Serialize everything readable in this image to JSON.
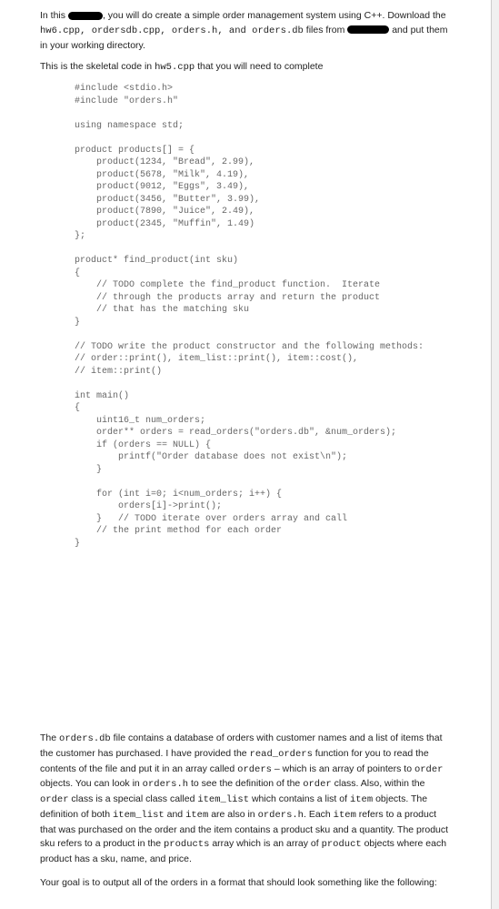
{
  "intro": {
    "p1_a": "In this ",
    "p1_b": ", you will do create a simple order management system using C++.  Download the ",
    "p1_c": " files from ",
    "p1_d": " and put them in your working directory.",
    "files_list": "hw6.cpp, ordersdb.cpp, orders.h, and orders.db",
    "p2_a": "This is the skeletal code in ",
    "p2_b": " that you will need to complete",
    "skeletal_file": "hw5.cpp"
  },
  "code": "#include <stdio.h>\n#include \"orders.h\"\n\nusing namespace std;\n\nproduct products[] = {\n    product(1234, \"Bread\", 2.99),\n    product(5678, \"Milk\", 4.19),\n    product(9012, \"Eggs\", 3.49),\n    product(3456, \"Butter\", 3.99),\n    product(7890, \"Juice\", 2.49),\n    product(2345, \"Muffin\", 1.49)\n};\n\nproduct* find_product(int sku)\n{\n    // TODO complete the find_product function.  Iterate\n    // through the products array and return the product\n    // that has the matching sku\n}\n\n// TODO write the product constructor and the following methods:\n// order::print(), item_list::print(), item::cost(),\n// item::print()\n\nint main()\n{\n    uint16_t num_orders;\n    order** orders = read_orders(\"orders.db\", &num_orders);\n    if (orders == NULL) {\n        printf(\"Order database does not exist\\n\");\n    }\n\n    for (int i=0; i<num_orders; i++) {\n        orders[i]->print();\n    }   // TODO iterate over orders array and call\n    // the print method for each order\n}",
  "bottom": {
    "p1_a": "The ",
    "p1_file1": "orders.db",
    "p1_b": " file contains a database of orders with customer names and a list of items that the customer has purchased.  I have provided the ",
    "p1_func": "read_orders",
    "p1_c": " function for you to read the contents of the file and put it in an array called ",
    "p1_arr": "orders",
    "p1_d": " – which is an array of pointers to ",
    "p1_order": "order",
    "p1_e": " objects.  You can look in ",
    "p1_file2": "orders.h",
    "p1_f": " to see the definition of the ",
    "p1_order2": "order",
    "p1_g": " class.  Also, within the ",
    "p1_order3": "order",
    "p1_h": " class is a special class called ",
    "p1_itemlist": "item_list",
    "p1_i": " which contains a list of ",
    "p1_item": "item",
    "p1_j": " objects.  The definition of both ",
    "p1_itemlist2": "item_list",
    "p1_k": " and ",
    "p1_item2": "item",
    "p1_l": " are also in ",
    "p1_file3": "orders.h",
    "p1_m": ".  Each ",
    "p1_item3": "item",
    "p1_n": " refers to a product that was purchased on the order and the item contains a product sku and a quantity.  The product sku refers to a product in the ",
    "p1_products": "products",
    "p1_o": " array which is an array of ",
    "p1_product": "product",
    "p1_p": " objects where each product has a sku, name, and price.",
    "p2": "Your goal is to output all of the orders in a format that should look something like the following:"
  }
}
